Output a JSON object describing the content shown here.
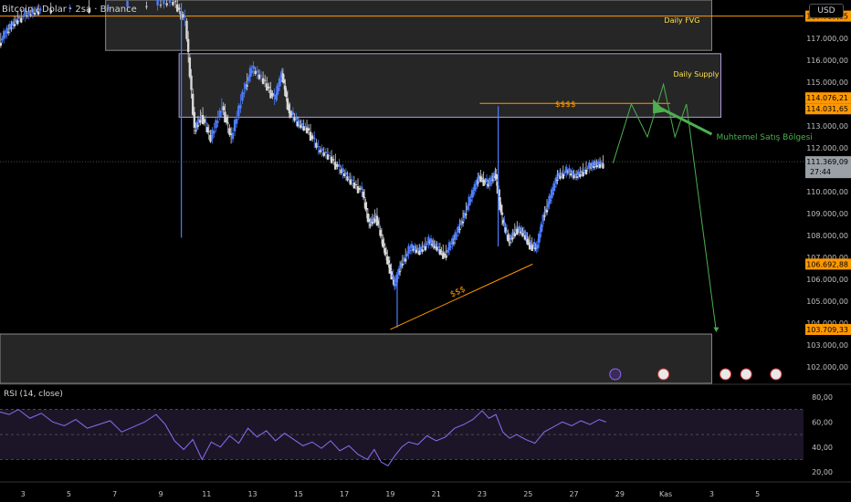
{
  "header": {
    "title": "Bitcoin / Dolar · 2sa · Binance",
    "currency": "USD"
  },
  "colors": {
    "up": "#4d7cff",
    "down": "#d8d8d8",
    "supply_stroke": "#b39ddb",
    "orange": "#ff9800",
    "projection": "#4caf50",
    "rsi": "#8c6cf0",
    "price_line": "#4a4a4a",
    "tag_text": "#000000"
  },
  "icons": {
    "flash": "lightning-icon",
    "event": "flag-icon"
  },
  "chart_data": {
    "type": "candlestick",
    "title": "Bitcoin / Dolar · 2sa · Binance",
    "ylim": [
      101250,
      118750
    ],
    "y_ticks": [
      102000,
      103000,
      104000,
      105000,
      106000,
      107000,
      108000,
      109000,
      110000,
      111000,
      112000,
      113000,
      114000,
      115000,
      116000,
      117000
    ],
    "y_tick_labels": [
      "102.000,00",
      "103.000,00",
      "104.000,00",
      "105.000,00",
      "106.000,00",
      "107.000,00",
      "108.000,00",
      "109.000,00",
      "110.000,00",
      "111.000,00",
      "112.000,00",
      "113.000,00",
      "114.000,00",
      "115.000,00",
      "116.000,00",
      "117.000,00"
    ],
    "x_ticks": [
      3,
      5,
      7,
      9,
      11,
      13,
      15,
      17,
      19,
      21,
      23,
      25,
      27,
      29,
      31,
      33,
      35
    ],
    "x_tick_labels": [
      "3",
      "5",
      "7",
      "9",
      "11",
      "13",
      "15",
      "17",
      "19",
      "21",
      "23",
      "25",
      "27",
      "29",
      "Kas",
      "3",
      "5"
    ],
    "xlim": [
      2,
      37
    ],
    "grid": false,
    "price_path": [
      [
        2.0,
        116800
      ],
      [
        2.4,
        117400
      ],
      [
        2.8,
        117900
      ],
      [
        3.3,
        118100
      ],
      [
        3.8,
        118300
      ],
      [
        8.8,
        118500
      ],
      [
        9.6,
        118700
      ],
      [
        10.1,
        117800
      ],
      [
        10.5,
        112800
      ],
      [
        10.8,
        113500
      ],
      [
        11.2,
        112400
      ],
      [
        11.7,
        113900
      ],
      [
        12.1,
        112400
      ],
      [
        12.6,
        114500
      ],
      [
        13.0,
        115600
      ],
      [
        13.5,
        115100
      ],
      [
        14.0,
        114200
      ],
      [
        14.3,
        115400
      ],
      [
        14.6,
        113700
      ],
      [
        15.0,
        113100
      ],
      [
        15.4,
        112900
      ],
      [
        15.9,
        111900
      ],
      [
        16.4,
        111600
      ],
      [
        16.9,
        110900
      ],
      [
        17.3,
        110500
      ],
      [
        17.8,
        110000
      ],
      [
        18.1,
        108500
      ],
      [
        18.4,
        108900
      ],
      [
        18.7,
        107600
      ],
      [
        19.0,
        106500
      ],
      [
        19.2,
        105700
      ],
      [
        19.5,
        106700
      ],
      [
        19.9,
        107400
      ],
      [
        20.3,
        107300
      ],
      [
        20.7,
        107700
      ],
      [
        21.0,
        107500
      ],
      [
        21.4,
        107100
      ],
      [
        21.8,
        107800
      ],
      [
        22.2,
        108800
      ],
      [
        22.6,
        109900
      ],
      [
        22.9,
        110700
      ],
      [
        23.3,
        110300
      ],
      [
        23.6,
        110800
      ],
      [
        23.9,
        108700
      ],
      [
        24.2,
        107700
      ],
      [
        24.5,
        108300
      ],
      [
        24.8,
        108100
      ],
      [
        25.1,
        107600
      ],
      [
        25.4,
        107400
      ],
      [
        25.7,
        108900
      ],
      [
        26.0,
        109700
      ],
      [
        26.3,
        110700
      ],
      [
        26.7,
        110900
      ],
      [
        27.1,
        110700
      ],
      [
        27.5,
        111000
      ],
      [
        27.9,
        111200
      ],
      [
        28.3,
        111300
      ]
    ],
    "vertical_spikes": [
      [
        9.9,
        107900,
        118600
      ],
      [
        23.7,
        107500,
        113900
      ],
      [
        19.3,
        103800,
        106200
      ]
    ],
    "zones": [
      {
        "name": "Daily FVG",
        "y_low": 116450,
        "y_high": 118750,
        "x_start": 6.6,
        "x_end": 33.0
      },
      {
        "name": "Daily Supply",
        "y_low": 113400,
        "y_high": 116300,
        "x_start": 9.8,
        "x_end": 33.4
      },
      {
        "name": "",
        "y_low": 101250,
        "y_high": 103500,
        "x_start": 2.0,
        "x_end": 33.0
      }
    ],
    "price_tags": [
      {
        "value": 118015.25,
        "label": "118.015,25",
        "color": "#ff9800"
      },
      {
        "value": 114076.21,
        "label": "114.076,21",
        "color": "#ff9800"
      },
      {
        "value": 114031.65,
        "label": "114.031,65",
        "color": "#ff9800"
      },
      {
        "value": 111369.09,
        "label": "111.369,09",
        "color": "#9aa0a6"
      },
      {
        "value": 106692.88,
        "label": "106.692,88",
        "color": "#ff9800"
      },
      {
        "value": 103709.33,
        "label": "103.709,33",
        "color": "#ff9800"
      }
    ],
    "countdown": "27:44",
    "liquidity_lines": [
      {
        "label": "$$$$",
        "y": 114031.65,
        "x_start": 22.9,
        "x_end": 31.2
      },
      {
        "label": "$$$",
        "points": [
          [
            19.0,
            103709.33
          ],
          [
            25.2,
            106692.88
          ]
        ]
      }
    ],
    "projection_path": [
      [
        28.7,
        111300
      ],
      [
        29.5,
        114000
      ],
      [
        30.2,
        112500
      ],
      [
        30.9,
        114900
      ],
      [
        31.4,
        112500
      ],
      [
        31.9,
        114000
      ],
      [
        33.2,
        103600
      ]
    ],
    "annotation": {
      "text": "Muhtemel Satış Bölgesi",
      "x": 33.2,
      "y": 112500
    },
    "event_markers": [
      {
        "type": "flash",
        "x": 28.8
      },
      {
        "type": "flag",
        "x": 30.9
      },
      {
        "type": "flag",
        "x": 33.6
      },
      {
        "type": "flag",
        "x": 34.5
      },
      {
        "type": "flag",
        "x": 35.8
      }
    ],
    "rsi": {
      "title": "RSI (14, close)",
      "ylim": [
        15,
        88
      ],
      "levels": [
        70,
        50,
        30
      ],
      "y_ticks": [
        80,
        60,
        40,
        20
      ],
      "y_tick_labels": [
        "80,00",
        "60,00",
        "40,00",
        "20,00"
      ],
      "path": [
        [
          2.0,
          68
        ],
        [
          2.4,
          66
        ],
        [
          2.8,
          70
        ],
        [
          3.3,
          63
        ],
        [
          3.8,
          67
        ],
        [
          4.3,
          60
        ],
        [
          4.8,
          57
        ],
        [
          5.3,
          62
        ],
        [
          5.8,
          55
        ],
        [
          6.3,
          58
        ],
        [
          6.8,
          61
        ],
        [
          7.3,
          52
        ],
        [
          7.8,
          56
        ],
        [
          8.3,
          60
        ],
        [
          8.8,
          66
        ],
        [
          9.2,
          58
        ],
        [
          9.6,
          45
        ],
        [
          10.0,
          38
        ],
        [
          10.4,
          46
        ],
        [
          10.8,
          30
        ],
        [
          11.2,
          44
        ],
        [
          11.6,
          40
        ],
        [
          12.0,
          49
        ],
        [
          12.4,
          43
        ],
        [
          12.8,
          55
        ],
        [
          13.2,
          48
        ],
        [
          13.6,
          53
        ],
        [
          14.0,
          45
        ],
        [
          14.4,
          51
        ],
        [
          14.8,
          46
        ],
        [
          15.2,
          41
        ],
        [
          15.6,
          44
        ],
        [
          16.0,
          39
        ],
        [
          16.4,
          45
        ],
        [
          16.8,
          37
        ],
        [
          17.2,
          41
        ],
        [
          17.6,
          34
        ],
        [
          18.0,
          30
        ],
        [
          18.3,
          38
        ],
        [
          18.6,
          28
        ],
        [
          18.9,
          25
        ],
        [
          19.2,
          33
        ],
        [
          19.5,
          40
        ],
        [
          19.8,
          44
        ],
        [
          20.2,
          42
        ],
        [
          20.6,
          49
        ],
        [
          21.0,
          45
        ],
        [
          21.4,
          48
        ],
        [
          21.8,
          55
        ],
        [
          22.2,
          58
        ],
        [
          22.6,
          62
        ],
        [
          23.0,
          69
        ],
        [
          23.3,
          63
        ],
        [
          23.6,
          66
        ],
        [
          23.9,
          52
        ],
        [
          24.2,
          47
        ],
        [
          24.5,
          50
        ],
        [
          24.9,
          46
        ],
        [
          25.3,
          43
        ],
        [
          25.7,
          52
        ],
        [
          26.1,
          56
        ],
        [
          26.5,
          60
        ],
        [
          26.9,
          57
        ],
        [
          27.3,
          61
        ],
        [
          27.7,
          58
        ],
        [
          28.1,
          62
        ],
        [
          28.4,
          60
        ]
      ]
    }
  }
}
